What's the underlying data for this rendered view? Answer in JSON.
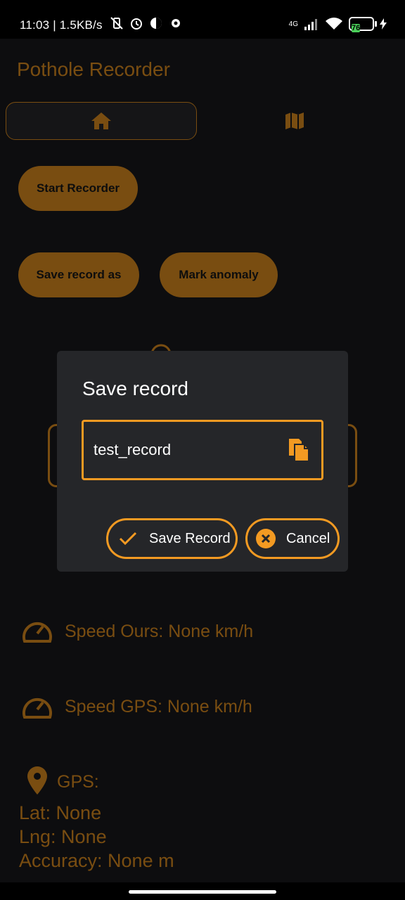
{
  "status": {
    "time": "11:03",
    "speed": "1.5KB/s",
    "network": "4G",
    "battery": "76"
  },
  "app": {
    "title": "Pothole Recorder"
  },
  "buttons": {
    "start": "Start Recorder",
    "save_as": "Save record as",
    "mark": "Mark anomaly"
  },
  "readouts": {
    "speed_ours": "Speed Ours:  None  km/h",
    "speed_gps": "Speed GPS:  None  km/h",
    "gps_label": "GPS:",
    "lat": "Lat:  None",
    "lng": "Lng:  None",
    "accuracy": "Accuracy: None m"
  },
  "dialog": {
    "title": "Save record",
    "input_value": "test_record",
    "save_label": "Save Record",
    "cancel_label": "Cancel"
  },
  "colors": {
    "accent": "#f39a22",
    "background": "#1a1b1e",
    "dialog": "#252629"
  }
}
